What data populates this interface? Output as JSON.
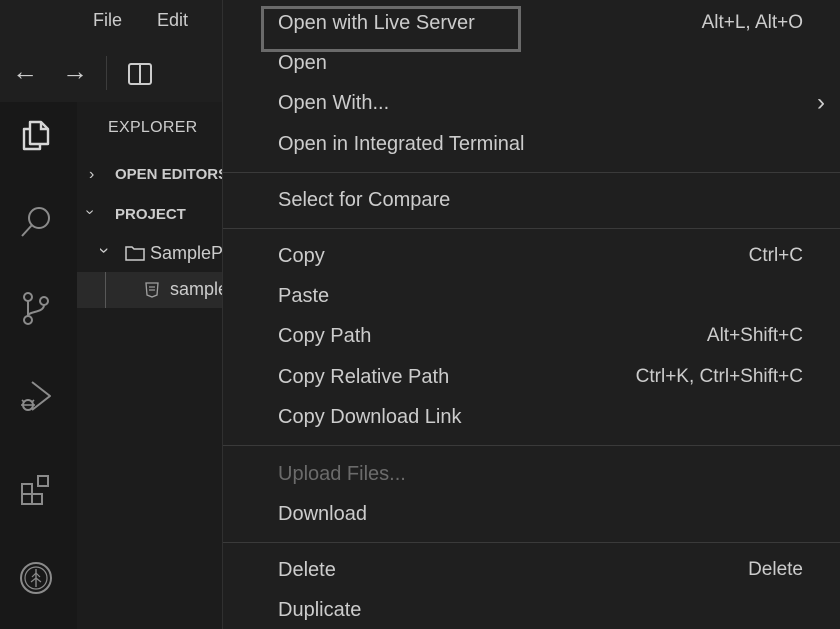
{
  "menubar": {
    "file": "File",
    "edit": "Edit"
  },
  "nav": {
    "back": "←",
    "forward": "→"
  },
  "activity_bar": {
    "icons": [
      "explorer-icon",
      "search-icon",
      "source-control-icon",
      "run-debug-icon",
      "extensions-icon",
      "tree-badge-icon"
    ]
  },
  "sidebar": {
    "title": "EXPLORER",
    "open_editors": "OPEN EDITORS",
    "project": "PROJECT",
    "folder": "SampleProject",
    "file": "sample.html"
  },
  "context_menu": {
    "items": [
      {
        "label": "Open with Live Server",
        "shortcut": "Alt+L, Alt+O"
      },
      {
        "label": "Open",
        "shortcut": ""
      },
      {
        "label": "Open With...",
        "shortcut": ""
      },
      {
        "label": "Open in Integrated Terminal",
        "shortcut": ""
      },
      {
        "label": "Select for Compare",
        "shortcut": ""
      },
      {
        "label": "Copy",
        "shortcut": "Ctrl+C"
      },
      {
        "label": "Paste",
        "shortcut": ""
      },
      {
        "label": "Copy Path",
        "shortcut": "Alt+Shift+C"
      },
      {
        "label": "Copy Relative Path",
        "shortcut": "Ctrl+K, Ctrl+Shift+C"
      },
      {
        "label": "Copy Download Link",
        "shortcut": ""
      },
      {
        "label": "Upload Files...",
        "shortcut": ""
      },
      {
        "label": "Download",
        "shortcut": ""
      },
      {
        "label": "Delete",
        "shortcut": "Delete"
      },
      {
        "label": "Duplicate",
        "shortcut": ""
      }
    ],
    "submenu_arrow": "›"
  }
}
